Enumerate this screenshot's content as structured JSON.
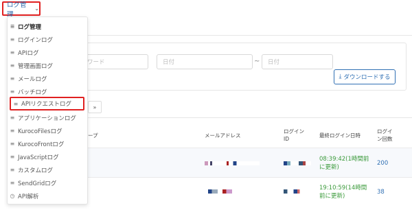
{
  "menu_trigger": {
    "label": "ログ管理",
    "chevron": "chevron-down-icon"
  },
  "dropdown": {
    "items": [
      {
        "label": "ログ管理",
        "icon": "list-icon"
      },
      {
        "label": "ログインログ",
        "icon": "list-icon"
      },
      {
        "label": "APIログ",
        "icon": "list-icon"
      },
      {
        "label": "管理画面ログ",
        "icon": "list-icon"
      },
      {
        "label": "メールログ",
        "icon": "list-icon"
      },
      {
        "label": "バッチログ",
        "icon": "list-icon"
      },
      {
        "label": "APIリクエストログ",
        "icon": "list-icon"
      },
      {
        "label": "アプリケーションログ",
        "icon": "list-icon"
      },
      {
        "label": "KurocoFilesログ",
        "icon": "list-icon"
      },
      {
        "label": "KurocoFrontログ",
        "icon": "list-icon"
      },
      {
        "label": "JavaScriptログ",
        "icon": "list-icon"
      },
      {
        "label": "カスタムログ",
        "icon": "list-icon"
      },
      {
        "label": "SendGridログ",
        "icon": "list-icon"
      },
      {
        "label": "API解析",
        "icon": "clock-icon"
      }
    ]
  },
  "filter": {
    "keyword_placeholder": "ワード",
    "date_from_placeholder": "日付",
    "date_to_placeholder": "日付",
    "separator": "~",
    "download_label": "ダウンロードする"
  },
  "pager": {
    "next_label": "»"
  },
  "table": {
    "headers": {
      "group": "ープ",
      "email": "メールアドレス",
      "login_id_1": "ログイン",
      "login_id_2": "ID",
      "last_login": "最終ログイン日時",
      "count_1": "ログイ",
      "count_2": "ン回数"
    },
    "rows": [
      {
        "time_1": "08:39:42(1時間前",
        "time_2": "に更新)",
        "count": "200"
      },
      {
        "time_1": "19:10:59(14時間",
        "time_2": "前に更新)",
        "count": "38"
      }
    ]
  },
  "colors": {
    "accent": "#2f6fb3",
    "highlight": "#e02020",
    "success": "#3a9a3a"
  }
}
